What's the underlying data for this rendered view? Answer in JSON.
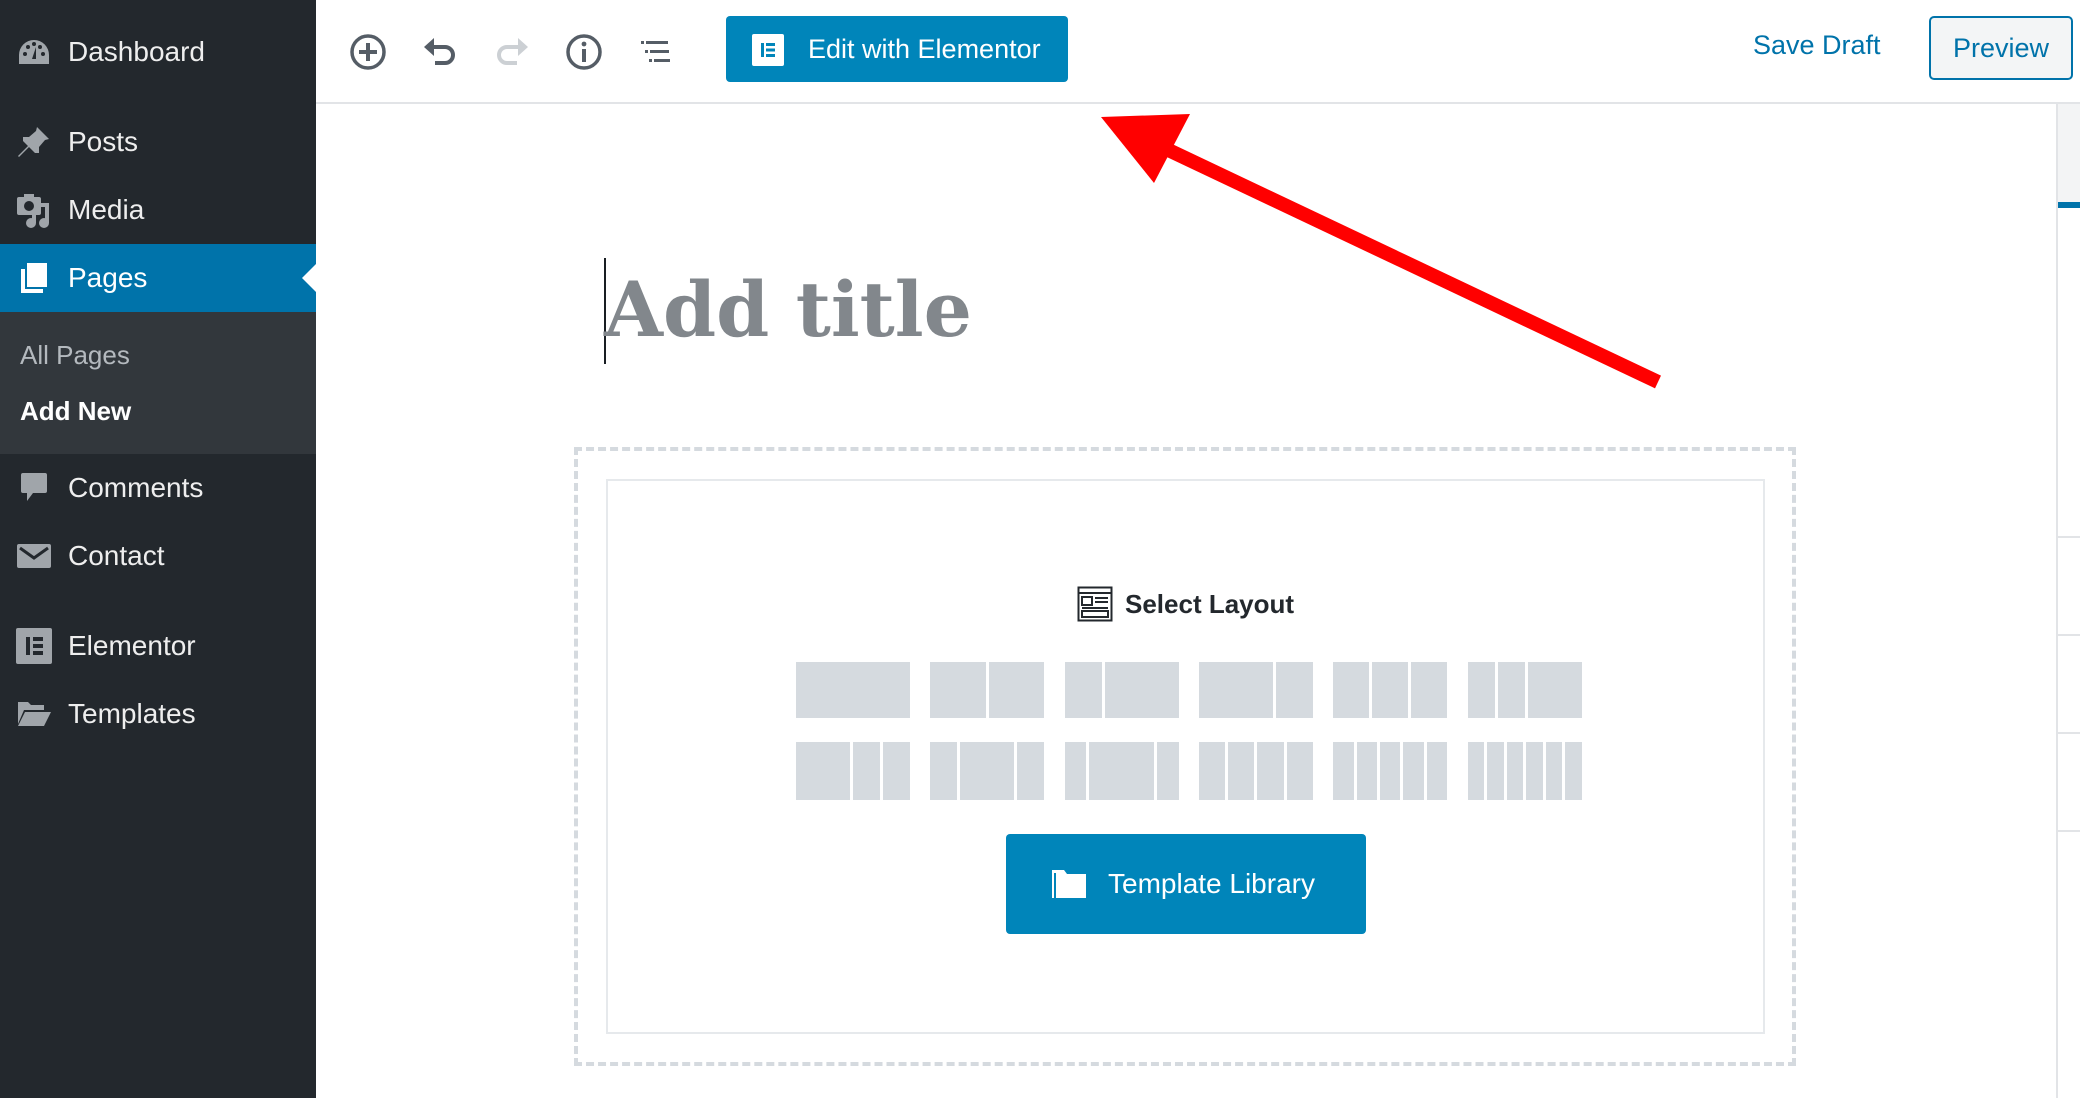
{
  "sidebar": {
    "items": [
      {
        "id": "dashboard",
        "label": "Dashboard",
        "icon": "dashboard-icon"
      },
      {
        "id": "posts",
        "label": "Posts",
        "icon": "pin-icon"
      },
      {
        "id": "media",
        "label": "Media",
        "icon": "media-icon"
      },
      {
        "id": "pages",
        "label": "Pages",
        "icon": "pages-icon",
        "active": true
      },
      {
        "id": "comments",
        "label": "Comments",
        "icon": "comment-icon"
      },
      {
        "id": "contact",
        "label": "Contact",
        "icon": "mail-icon"
      },
      {
        "id": "elementor",
        "label": "Elementor",
        "icon": "elementor-icon"
      },
      {
        "id": "templates",
        "label": "Templates",
        "icon": "folder-open-icon"
      }
    ],
    "submenu": [
      {
        "label": "All Pages",
        "current": false
      },
      {
        "label": "Add New",
        "current": true
      }
    ]
  },
  "toolbar": {
    "icons": [
      "add-block-icon",
      "undo-icon",
      "redo-icon",
      "info-icon",
      "outline-icon"
    ],
    "edit_elementor_label": "Edit with Elementor",
    "save_draft_label": "Save Draft",
    "preview_label": "Preview"
  },
  "editor": {
    "title_placeholder": "Add title",
    "select_layout_label": "Select Layout",
    "layout_presets": [
      [
        1
      ],
      [
        1,
        1
      ],
      [
        1,
        2
      ],
      [
        2,
        1
      ],
      [
        1,
        1,
        1
      ],
      [
        1,
        1,
        2
      ],
      [
        2,
        1,
        1
      ],
      [
        1,
        2,
        1
      ],
      [
        1,
        3,
        1
      ],
      [
        1,
        1,
        1,
        1
      ],
      [
        1,
        1,
        1,
        1,
        1
      ],
      [
        1,
        1,
        1,
        1,
        1,
        1
      ]
    ],
    "template_library_label": "Template Library"
  },
  "colors": {
    "accent": "#0085ba",
    "link": "#0073aa",
    "sidebar_bg": "#23282d",
    "annotation": "#ff0000"
  }
}
